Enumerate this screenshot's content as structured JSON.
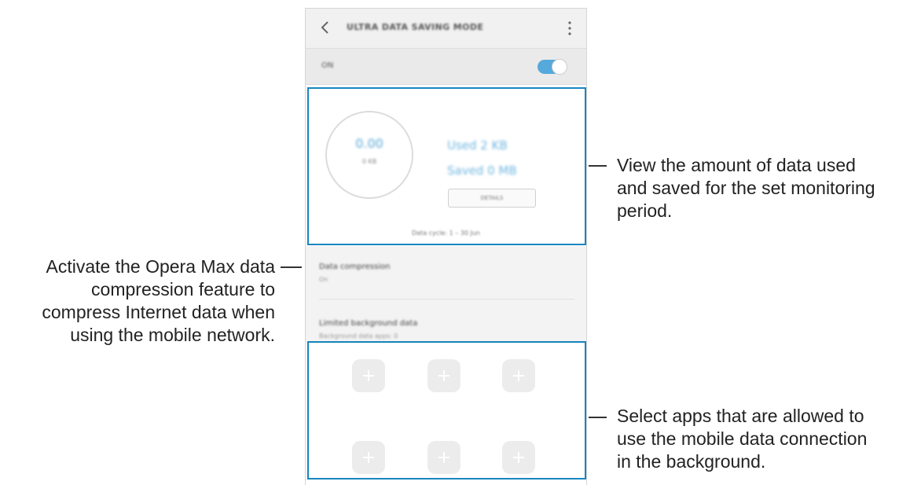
{
  "screen": {
    "title": "ULTRA DATA SAVING MODE",
    "master_switch": {
      "label": "ON",
      "state": "on",
      "accent": "#55a9db"
    },
    "usage": {
      "gauge_value": "0.00",
      "gauge_caption": "0 KB",
      "used": "Used 2 KB",
      "saved": "Saved 0 MB",
      "details_label": "DETAILS",
      "cycle": "Data cycle: 1 – 30 Jun"
    },
    "settings": [
      {
        "title": "Data compression",
        "subtitle": "On"
      },
      {
        "title": "Limited background data",
        "subtitle": "Background data apps: 0"
      }
    ],
    "app_slots": {
      "count": 6,
      "icon": "plus-icon"
    }
  },
  "callouts": {
    "usage": [
      "View the amount of data used",
      "and saved for the set monitoring",
      "period."
    ],
    "compression": [
      "Activate the Opera Max data",
      "compression feature to",
      "compress Internet data when",
      "using the mobile network."
    ],
    "apps": [
      "Select apps that are allowed to",
      "use the mobile data connection",
      "in the background."
    ]
  },
  "colors": {
    "highlight": "#1786bf",
    "accent": "#55a9db"
  }
}
